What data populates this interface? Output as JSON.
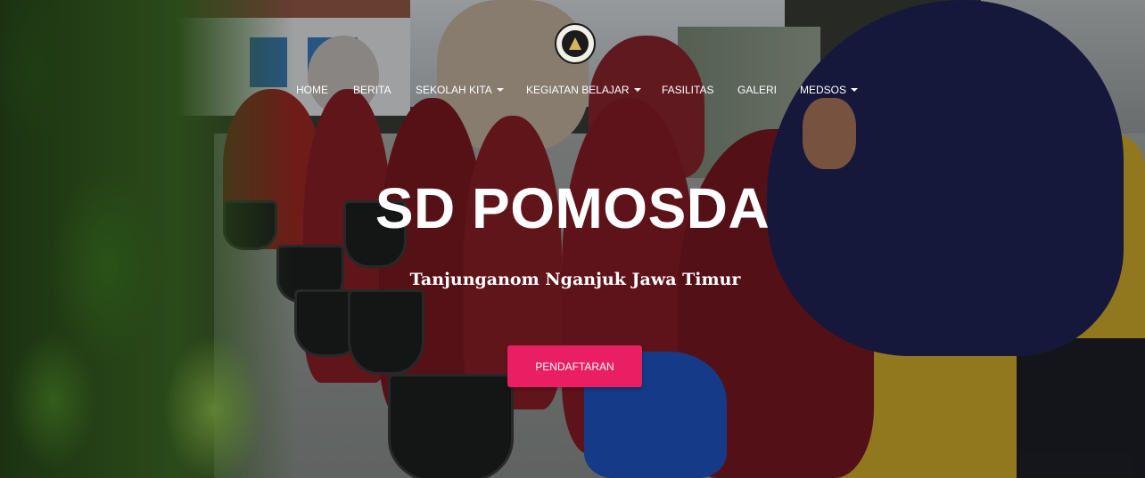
{
  "brand": {
    "logo_icon": "school-crest-icon"
  },
  "nav": {
    "items": [
      {
        "label": "HOME",
        "dropdown": false
      },
      {
        "label": "BERITA",
        "dropdown": false
      },
      {
        "label": "SEKOLAH KITA",
        "dropdown": true
      },
      {
        "label": "KEGIATAN BELAJAR",
        "dropdown": true
      },
      {
        "label": "FASILITAS",
        "dropdown": false
      },
      {
        "label": "GALERI",
        "dropdown": false
      },
      {
        "label": "MEDSOS",
        "dropdown": true
      }
    ]
  },
  "hero": {
    "title": "SD POMOSDA",
    "subtitle": "Tanjunganom Nganjuk Jawa Timur",
    "cta_label": "PENDAFTARAN"
  },
  "colors": {
    "cta_background": "#e91e63",
    "text": "#ffffff"
  }
}
